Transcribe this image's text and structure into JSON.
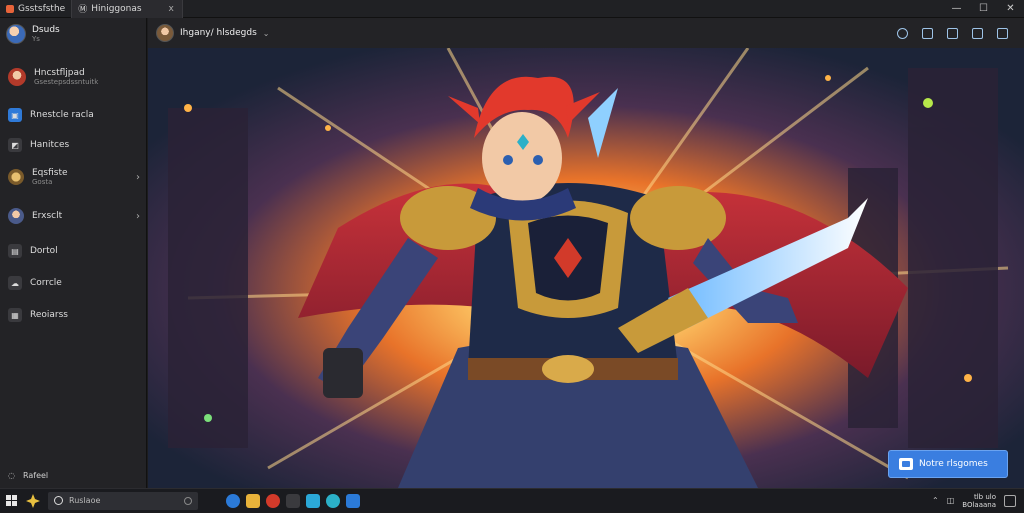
{
  "tabs": [
    {
      "label": "Gsstsfsthe",
      "active": false
    },
    {
      "label": "Hiniggonas",
      "active": true,
      "close": "x"
    }
  ],
  "window_controls": {
    "minimize": "—",
    "maximize": "☐",
    "close": "✕"
  },
  "sidebar": {
    "profile": {
      "name": "Dsuds",
      "sub": "Ys"
    },
    "items": [
      {
        "label": "Hncstfljpad",
        "sub": "Gsestepsdssntuitk",
        "icon": "avatar-icon",
        "chevron": false
      },
      {
        "label": "Rnestcle racla",
        "icon": "image-icon",
        "chevron": false
      },
      {
        "label": "Hanitces",
        "icon": "photo-icon",
        "chevron": false
      },
      {
        "label": "Eqsfiste",
        "sub": "Gosta",
        "icon": "gallery-icon",
        "chevron": true
      },
      {
        "label": "Erxsclt",
        "icon": "account-icon",
        "chevron": true
      },
      {
        "label": "Dortol",
        "icon": "folder-icon",
        "chevron": false
      },
      {
        "label": "Corrcle",
        "icon": "cloud-icon",
        "chevron": false
      },
      {
        "label": "Reoiarss",
        "icon": "settings-icon",
        "chevron": false
      }
    ],
    "footer": "Rafeel"
  },
  "header": {
    "title": "Ihgany/ hlsdegds",
    "caret": "⌄"
  },
  "cta": {
    "label": "Notre rlsgomes"
  },
  "taskbar": {
    "search_placeholder": "Ruslaoe",
    "clock_line1": "tlb ulo",
    "clock_line2": "BOlaaana"
  },
  "colors": {
    "accent": "#3a7ee0",
    "sidebar_bg": "#232326",
    "titlebar_bg": "#202124"
  }
}
